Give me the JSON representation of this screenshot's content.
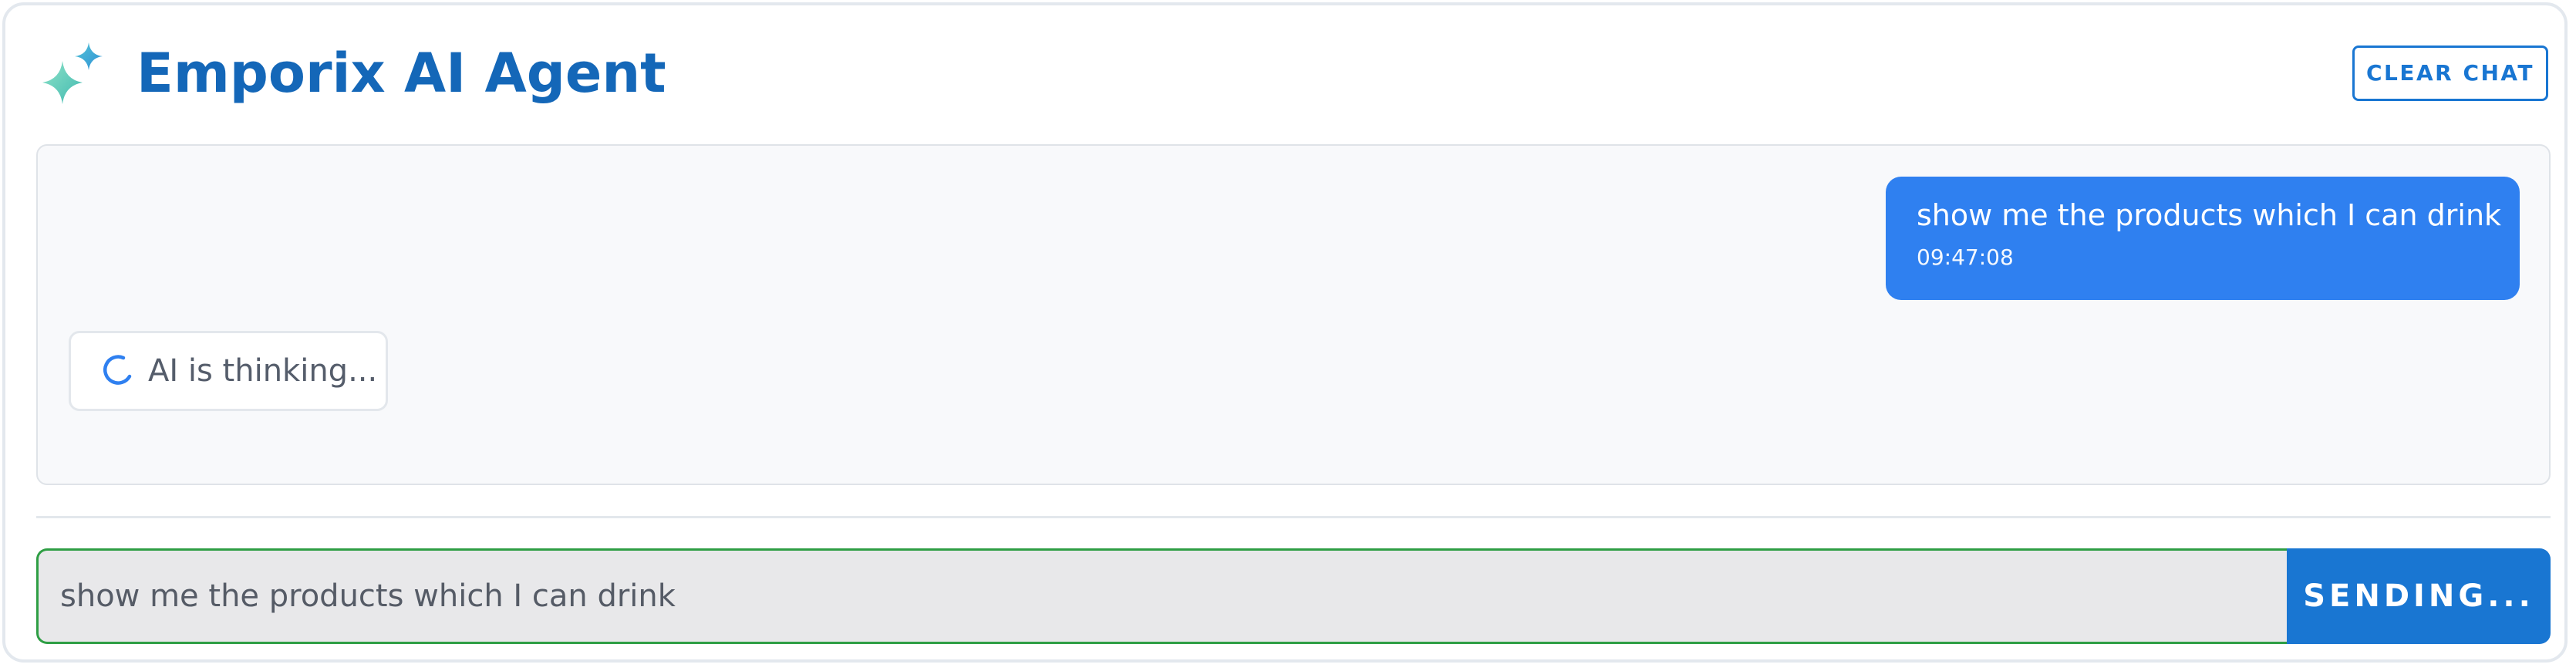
{
  "header": {
    "logo_icon": "sparkles-icon",
    "title": "Emporix AI Agent",
    "clear_label": "CLEAR CHAT"
  },
  "chat": {
    "messages": [
      {
        "role": "user",
        "text": "show me the products which I can drink",
        "time": "09:47:08"
      }
    ],
    "thinking": {
      "icon": "spinner-icon",
      "text": "AI is thinking..."
    }
  },
  "composer": {
    "value": "show me the products which I can drink",
    "send_label": "SENDING..."
  },
  "colors": {
    "brand": "#1467b8",
    "accent": "#1976d2",
    "user_bubble": "#2f80f0",
    "input_focus_border": "#2e9e44",
    "sparkle_light": "#7fd9c5",
    "sparkle_dark": "#3aa0d8"
  }
}
